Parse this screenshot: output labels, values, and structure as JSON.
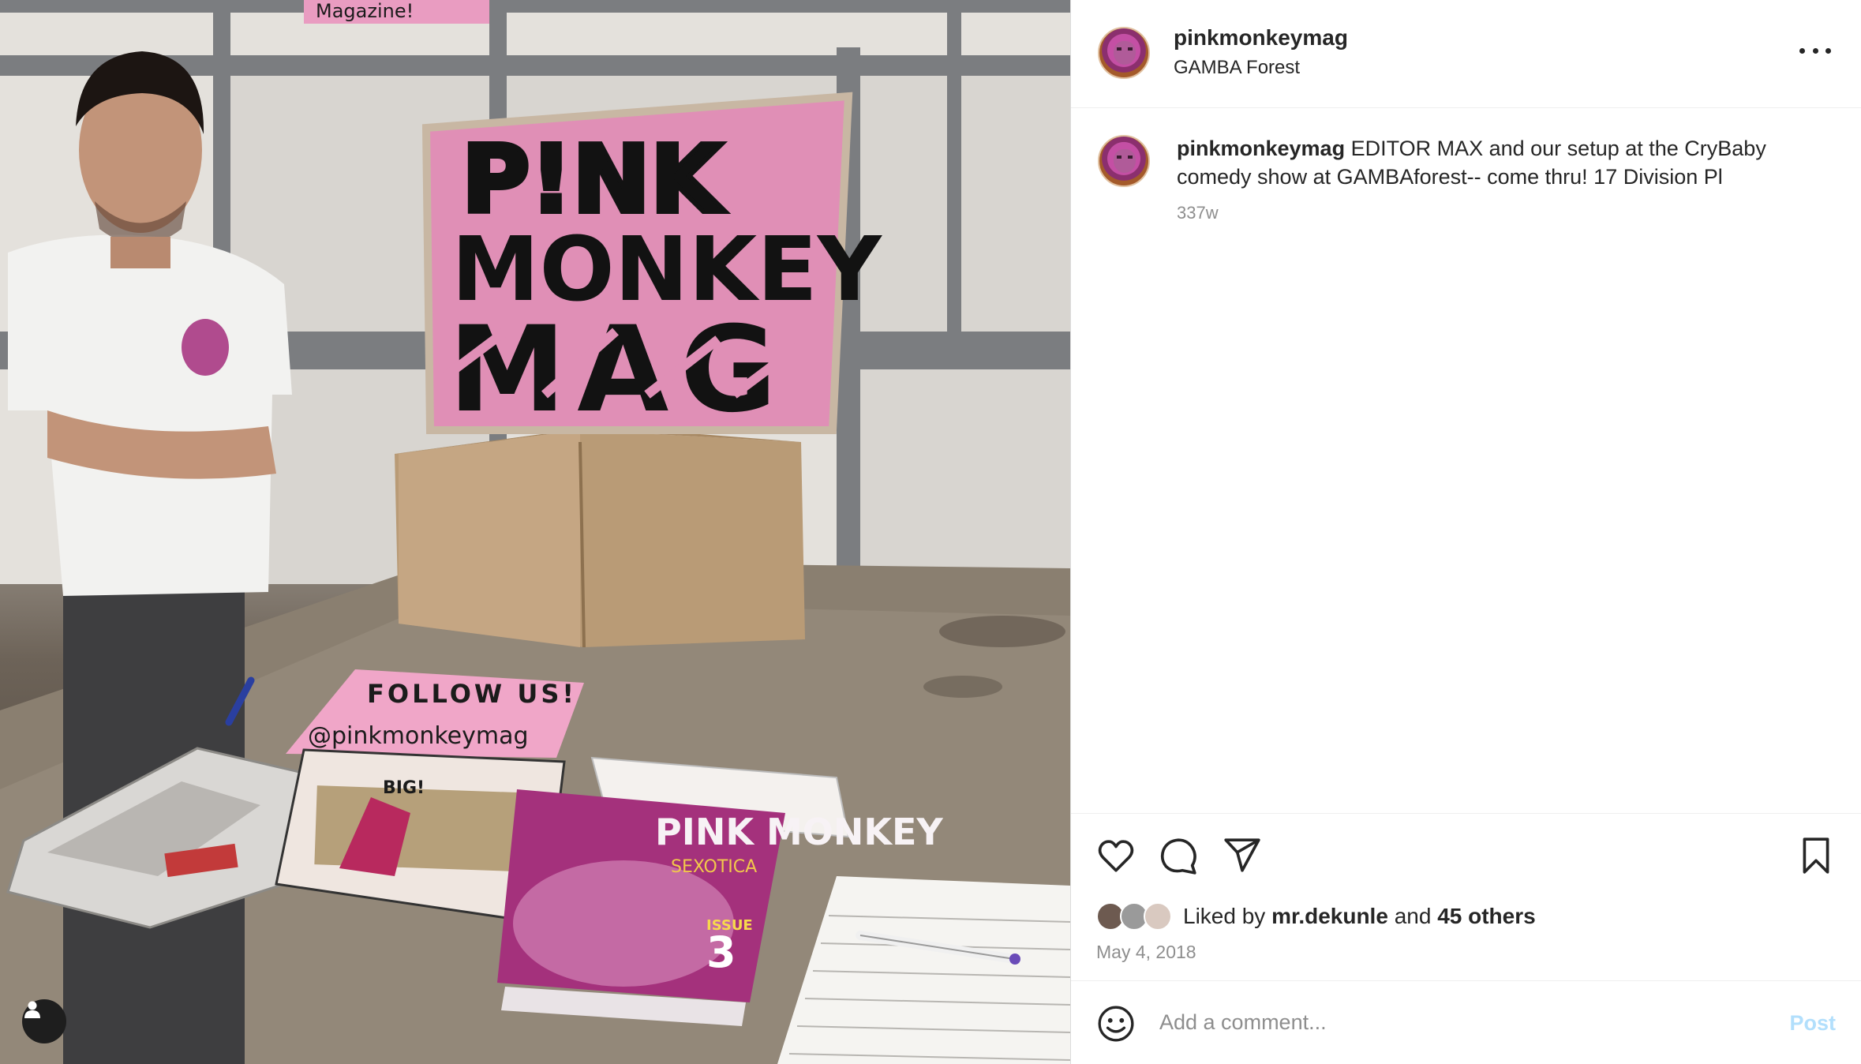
{
  "photo": {
    "sign_line1": "P!NK",
    "sign_line2": "MONKEY",
    "sign_line3": "MAG",
    "follow_card_title": "FOLLOW US!",
    "follow_card_handle": "@pinkmonkeymag",
    "top_sign_partial": "Magazine!",
    "magazine_issue_label": "ISSUE",
    "magazine_issue_number": "3",
    "magazine_title": "PINK MONKEY",
    "magazine_subtitle": "SEXOTICA",
    "comic_title": "BIG!"
  },
  "header": {
    "username": "pinkmonkeymag",
    "location": "GAMBA Forest"
  },
  "caption": {
    "username": "pinkmonkeymag",
    "text": "EDITOR MAX and our setup at the CryBaby comedy show at GAMBAforest-- come thru! 17 Division Pl",
    "time_ago": "337w"
  },
  "likes": {
    "prefix": "Liked by",
    "first_liker": "mr.dekunle",
    "conjunction": "and",
    "others": "45 others"
  },
  "date": "May 4, 2018",
  "comment": {
    "placeholder": "Add a comment...",
    "post_label": "Post"
  },
  "icons": {
    "like": "heart-icon",
    "comment": "comment-bubble-icon",
    "share": "paper-plane-icon",
    "save": "bookmark-icon",
    "emoji": "smiley-icon",
    "more": "more-options-icon",
    "tagged_user": "user-icon"
  },
  "colors": {
    "text_primary": "#262626",
    "text_secondary": "#8e8e8e",
    "post_button_disabled": "#b2dffc",
    "sign_pink": "#e890b8"
  }
}
